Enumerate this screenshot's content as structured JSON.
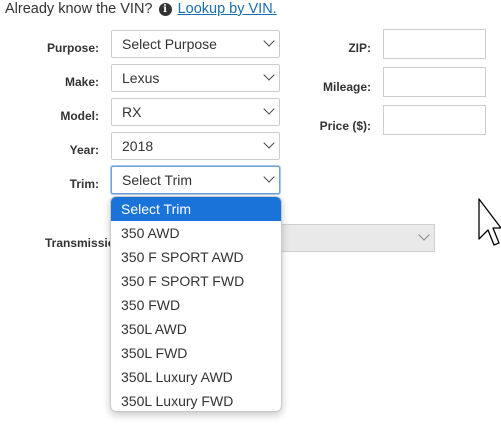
{
  "vin": {
    "prompt": "Already know the VIN?",
    "info_icon": "info-icon",
    "link": "Lookup by VIN."
  },
  "form": {
    "purpose": {
      "label": "Purpose:",
      "value": "Select Purpose"
    },
    "make": {
      "label": "Make:",
      "value": "Lexus"
    },
    "model": {
      "label": "Model:",
      "value": "RX"
    },
    "year": {
      "label": "Year:",
      "value": "2018"
    },
    "trim": {
      "label": "Trim:",
      "value": "Select Trim"
    },
    "transmission": {
      "label": "Transmissio",
      "value": ""
    },
    "zip": {
      "label": "ZIP:",
      "value": ""
    },
    "mileage": {
      "label": "Mileage:",
      "value": ""
    },
    "price": {
      "label": "Price ($):",
      "value": ""
    }
  },
  "trim_dropdown": {
    "options": [
      "Select Trim",
      "350 AWD",
      "350 F SPORT AWD",
      "350 F SPORT FWD",
      "350 FWD",
      "350L AWD",
      "350L FWD",
      "350L Luxury AWD",
      "350L Luxury FWD"
    ],
    "highlighted": "Select Trim"
  },
  "colors": {
    "link": "#1a6fb0",
    "highlight": "#1a73d9",
    "focus_border": "#6ea3d8"
  }
}
